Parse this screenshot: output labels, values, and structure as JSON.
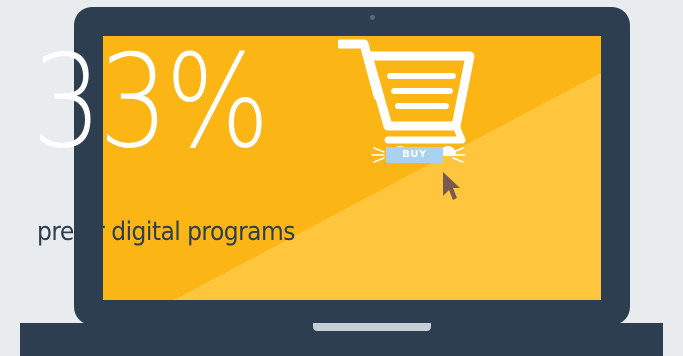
{
  "stat": {
    "value": "33%",
    "caption": "prefer digital programs"
  },
  "cart": {
    "buy_label": "BUY",
    "icon": "shopping-cart-icon"
  },
  "colors": {
    "background": "#e9ecee",
    "laptop_frame": "#2d3e50",
    "screen_primary": "#fbb514",
    "screen_secondary": "#ffc53c",
    "stat_text": "#ffffff",
    "caption_text": "#2c3e50",
    "buy_button": "#a8d2ef"
  }
}
